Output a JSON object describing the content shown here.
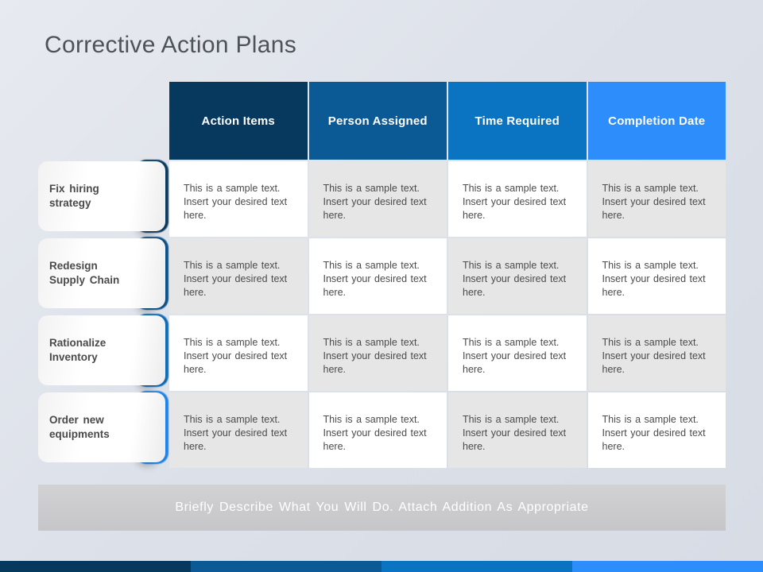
{
  "slide": {
    "title": "Corrective Action Plans"
  },
  "table": {
    "columns": [
      {
        "label": "Action Items",
        "color": "#07395F"
      },
      {
        "label": "Person Assigned",
        "color": "#0B5A96"
      },
      {
        "label": "Time Required",
        "color": "#0A73C2"
      },
      {
        "label": "Completion Date",
        "color": "#2D8EFB"
      }
    ],
    "rows": [
      {
        "label": "Fix hiring\nstrategy",
        "accent": "#0B3A5E",
        "shades": [
          "white",
          "gray",
          "white",
          "gray"
        ],
        "cells": [
          "This is a sample  text. Insert your desired text here.",
          "This is a sample  text. Insert your desired text here.",
          "This is a sample  text. Insert your desired text here.",
          "This is a sample  text. Insert your desired text here."
        ]
      },
      {
        "label": "Redesign\nSupply Chain",
        "accent": "#0C5288",
        "shades": [
          "gray",
          "white",
          "gray",
          "white"
        ],
        "cells": [
          "This is a sample  text. Insert your desired text here.",
          "This is a sample  text. Insert your desired text here.",
          "This is a sample  text. Insert your desired text here.",
          "This is a sample  text. Insert your desired text here."
        ]
      },
      {
        "label": "Rationalize\nInventory",
        "accent": "#0F6CB4",
        "shades": [
          "white",
          "gray",
          "white",
          "gray"
        ],
        "cells": [
          "This is a sample  text. Insert your desired text here.",
          "This is a sample  text. Insert your desired text here.",
          "This is a sample  text. Insert your desired text here.",
          "This is a sample  text. Insert your desired text here."
        ]
      },
      {
        "label": "Order new\nequipments",
        "accent": "#2083E8",
        "shades": [
          "gray",
          "white",
          "gray",
          "white"
        ],
        "cells": [
          "This is a sample  text. Insert your desired text here.",
          "This is a sample  text. Insert your desired text here.",
          "This is a sample  text. Insert your desired text here.",
          "This is a sample  text. Insert your desired text here."
        ]
      }
    ]
  },
  "footer": {
    "text": "Briefly Describe What You Will Do. Attach Addition As Appropriate"
  },
  "accent_strip": {
    "segments": [
      "#07395F",
      "#0B5A96",
      "#0A73C2",
      "#2D8EFB"
    ]
  }
}
